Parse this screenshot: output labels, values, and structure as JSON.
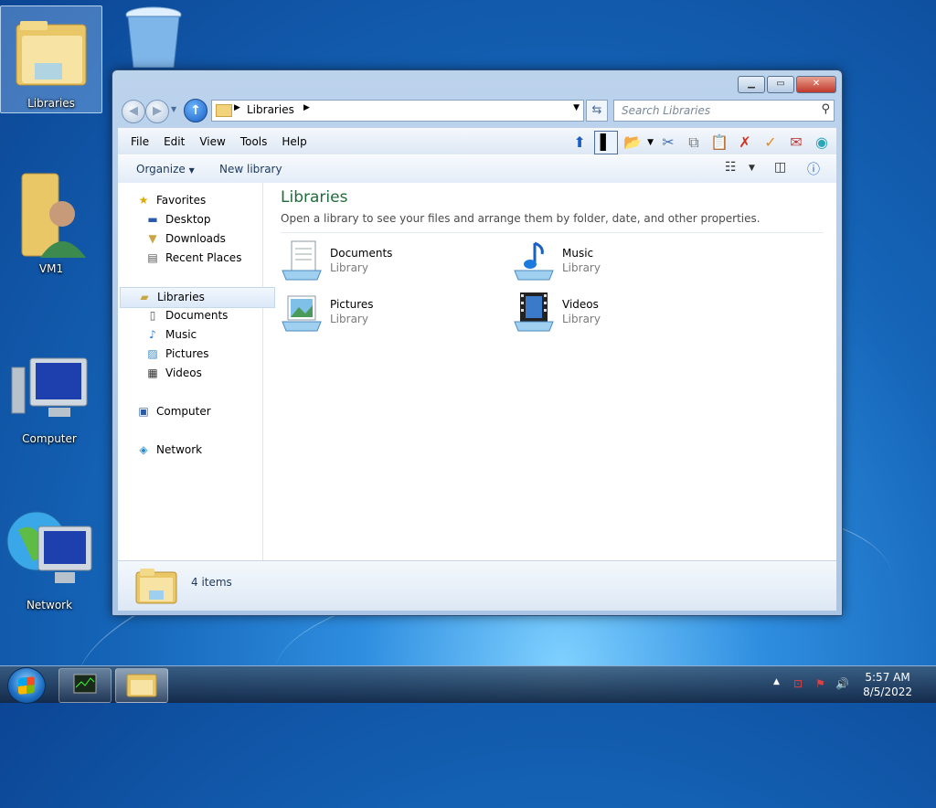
{
  "desktop": {
    "icons": [
      {
        "label": "Libraries"
      },
      {
        "label": ""
      },
      {
        "label": "VM1"
      },
      {
        "label": "Computer"
      },
      {
        "label": "Network"
      }
    ]
  },
  "window": {
    "address": {
      "crumb": "Libraries"
    },
    "search": {
      "placeholder": "Search Libraries"
    },
    "menu": [
      "File",
      "Edit",
      "View",
      "Tools",
      "Help"
    ],
    "command": {
      "organize": "Organize",
      "new_library": "New library"
    },
    "nav": {
      "favorites": "Favorites",
      "desktop": "Desktop",
      "downloads": "Downloads",
      "recent": "Recent Places",
      "libraries": "Libraries",
      "documents": "Documents",
      "music": "Music",
      "pictures": "Pictures",
      "videos": "Videos",
      "computer": "Computer",
      "network": "Network"
    },
    "content": {
      "title": "Libraries",
      "subtitle": "Open a library to see your files and arrange them by folder, date, and other properties.",
      "libraries": [
        {
          "name": "Documents",
          "type": "Library"
        },
        {
          "name": "Music",
          "type": "Library"
        },
        {
          "name": "Pictures",
          "type": "Library"
        },
        {
          "name": "Videos",
          "type": "Library"
        }
      ]
    },
    "status": {
      "count": "4 items"
    }
  },
  "taskbar": {
    "time": "5:57 AM",
    "date": "8/5/2022"
  },
  "colors": {
    "title_green": "#1e6c3a",
    "accent_blue": "#1a5fc2"
  }
}
